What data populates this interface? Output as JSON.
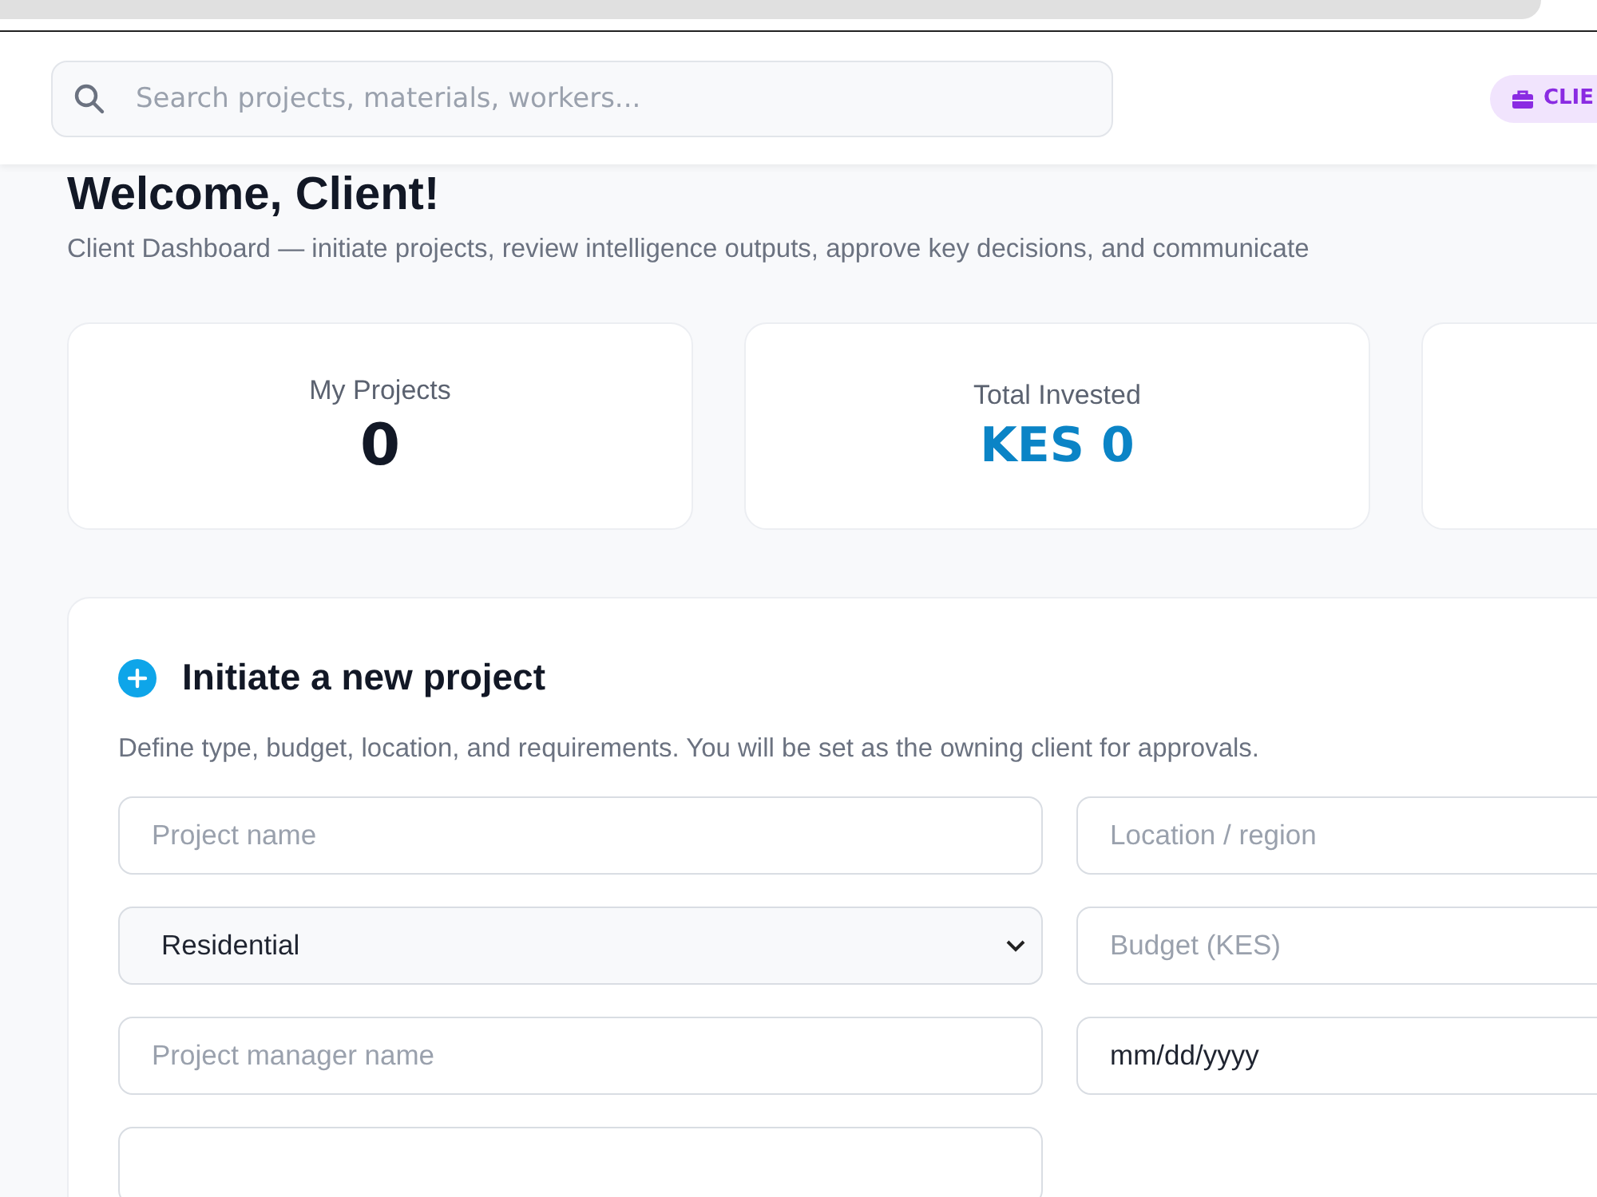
{
  "search": {
    "placeholder": "Search projects, materials, workers..."
  },
  "role_badge": {
    "label": "CLIE"
  },
  "welcome": {
    "title": "Welcome, Client!",
    "subtitle": "Client Dashboard — initiate projects, review intelligence outputs, approve key decisions, and communicate"
  },
  "stats": [
    {
      "label": "My Projects",
      "value": "0",
      "kind": "plain"
    },
    {
      "label": "Total Invested",
      "value": "KES 0",
      "kind": "money"
    },
    {
      "kind": "empty"
    }
  ],
  "new_project": {
    "title": "Initiate a new project",
    "description": "Define type, budget, location, and requirements. You will be set as the owning client for approvals.",
    "fields": [
      {
        "kind": "text",
        "placeholder": "Project name"
      },
      {
        "kind": "text",
        "placeholder": "Location / region"
      },
      {
        "kind": "select",
        "value": "Residential"
      },
      {
        "kind": "text",
        "placeholder": "Budget (KES)"
      },
      {
        "kind": "text",
        "placeholder": "Project manager name"
      },
      {
        "kind": "date",
        "value": "mm/dd/yyyy"
      },
      {
        "kind": "text"
      }
    ]
  }
}
